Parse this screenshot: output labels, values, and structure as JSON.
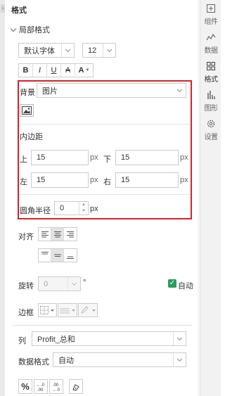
{
  "panel": {
    "title": "格式",
    "section": "局部格式",
    "font": {
      "family": "默认字体",
      "size": "12"
    },
    "format_buttons": [
      "B",
      "I",
      "U",
      "A",
      "A"
    ],
    "background": {
      "label": "背景",
      "value": "图片"
    },
    "padding": {
      "title": "内边距",
      "top_label": "上",
      "top_value": "15",
      "bottom_label": "下",
      "bottom_value": "15",
      "left_label": "左",
      "left_value": "15",
      "right_label": "右",
      "right_value": "15",
      "unit": "px"
    },
    "radius": {
      "label": "圆角半径",
      "value": "0",
      "unit": "px"
    },
    "align": {
      "label": "对齐"
    },
    "rotate": {
      "label": "旋转",
      "value": "0",
      "unit": "°",
      "auto_label": "自动",
      "auto_checked": true
    },
    "border": {
      "label": "边框"
    },
    "column": {
      "label": "列",
      "value": "Profit_总和"
    },
    "data_format": {
      "label": "数据格式",
      "value": "自动"
    },
    "highlight_color": "#d9202a",
    "check_color": "#2c9d5b"
  },
  "nav": {
    "items": [
      {
        "label": "组件",
        "icon": "component-icon"
      },
      {
        "label": "数据",
        "icon": "data-icon"
      },
      {
        "label": "格式",
        "icon": "format-icon"
      },
      {
        "label": "图形",
        "icon": "chart-icon"
      },
      {
        "label": "设置",
        "icon": "settings-icon"
      }
    ],
    "active": "格式"
  }
}
